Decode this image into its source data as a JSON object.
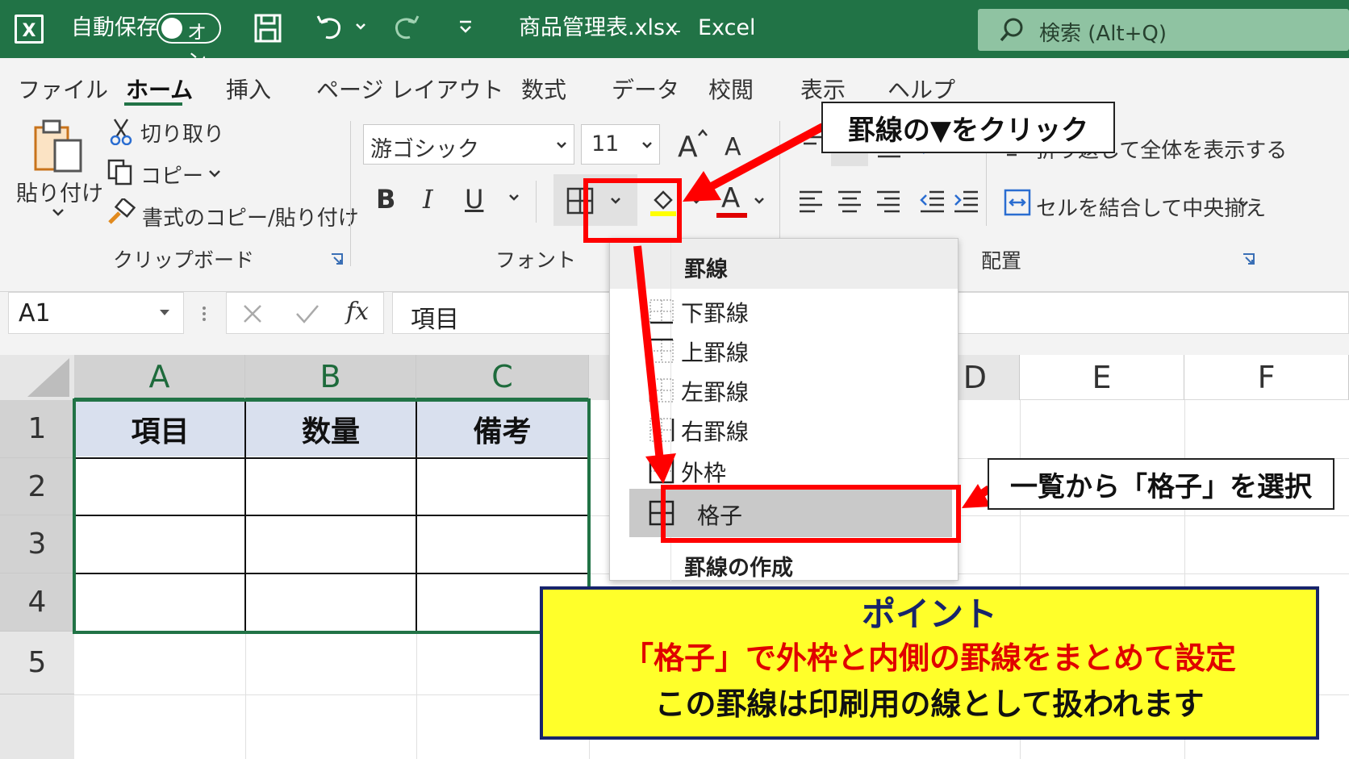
{
  "titlebar": {
    "autosave_label": "自動保存",
    "toggle_label": "オン",
    "filename": "商品管理表.xlsx",
    "separator": "-",
    "app": "Excel",
    "search_placeholder": "検索 (Alt+Q)",
    "color": "#217346"
  },
  "tabs": [
    "ファイル",
    "ホーム",
    "挿入",
    "ページ レイアウト",
    "数式",
    "データ",
    "校閲",
    "表示",
    "ヘルプ"
  ],
  "ribbon": {
    "clipboard": {
      "paste": "貼り付け",
      "cut": "切り取り",
      "copy": "コピー",
      "format_painter": "書式のコピー/貼り付け",
      "group_label": "クリップボード"
    },
    "font": {
      "font_name": "游ゴシック",
      "font_size": "11",
      "bold": "B",
      "italic": "I",
      "underline": "U",
      "font_color_glyph": "A",
      "group_label": "フォント"
    },
    "alignment": {
      "wrap_text": "折り返して全体を表示する",
      "merge_center": "セルを結合して中央揃え",
      "group_label": "配置"
    }
  },
  "formula_bar": {
    "name_box": "A1",
    "fx": "fx",
    "content": "項目"
  },
  "grid": {
    "columns": [
      "A",
      "B",
      "C",
      "D",
      "E",
      "F"
    ],
    "rows": [
      "1",
      "2",
      "3",
      "4",
      "5"
    ],
    "header_row": [
      "項目",
      "数量",
      "備考"
    ]
  },
  "borders_menu": {
    "header": "罫線",
    "items": [
      "下罫線",
      "上罫線",
      "左罫線",
      "右罫線",
      "外枠",
      "格子"
    ],
    "selected": "格子",
    "section2": "罫線の作成"
  },
  "annotations": {
    "callout1": "罫線の▼をクリック",
    "callout2": "一覧から「格子」を選択",
    "point_title": "ポイント",
    "point_line1": "「格子」で外枠と内側の罫線をまとめて設定",
    "point_line2": "この罫線は印刷用の線として扱われます",
    "highlight_color": "#ff0000",
    "point_bg": "#ffff2a"
  }
}
